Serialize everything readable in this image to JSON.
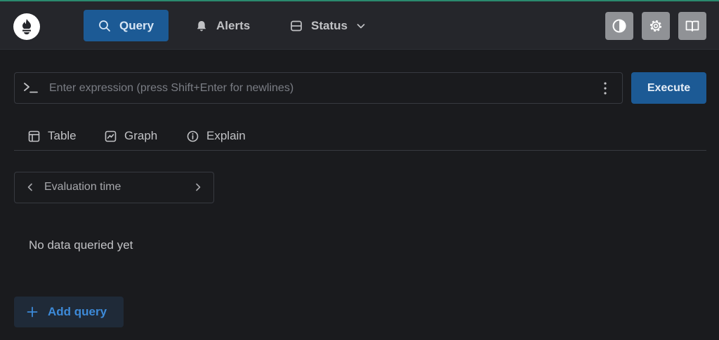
{
  "nav": {
    "query_label": "Query",
    "alerts_label": "Alerts",
    "status_label": "Status"
  },
  "icons": {
    "logo": "prometheus-logo-icon",
    "query": "search-icon",
    "alerts": "bell-icon",
    "status": "server-icon",
    "theme": "contrast-icon",
    "settings": "gear-icon",
    "docs": "book-icon"
  },
  "expression": {
    "placeholder": "Enter expression (press Shift+Enter for newlines)",
    "value": ""
  },
  "execute_label": "Execute",
  "tabs": [
    {
      "label": "Table"
    },
    {
      "label": "Graph"
    },
    {
      "label": "Explain"
    }
  ],
  "evaluation": {
    "label": "Evaluation time"
  },
  "empty_message": "No data queried yet",
  "add_query_label": "Add query",
  "colors": {
    "accent": "#1c5a95",
    "background": "#1a1b1e",
    "header": "#25262b",
    "link": "#3d8ad8"
  }
}
